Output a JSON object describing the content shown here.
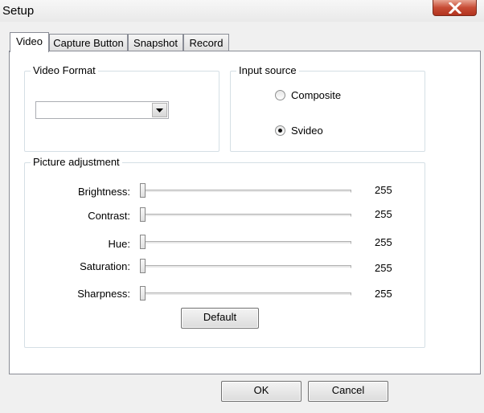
{
  "window": {
    "title": "Setup",
    "close_icon": "close-icon"
  },
  "tabs": [
    {
      "label": "Video",
      "active": true
    },
    {
      "label": "Capture Button",
      "active": false
    },
    {
      "label": "Snapshot",
      "active": false
    },
    {
      "label": "Record",
      "active": false
    }
  ],
  "video_format": {
    "title": "Video Format",
    "selected": ""
  },
  "input_source": {
    "title": "Input source",
    "options": [
      {
        "label": "Composite",
        "checked": false
      },
      {
        "label": "Svideo",
        "checked": true
      }
    ]
  },
  "picture_adjustment": {
    "title": "Picture adjustment",
    "sliders": [
      {
        "label": "Brightness:",
        "value": "255",
        "fraction": 0
      },
      {
        "label": "Contrast:",
        "value": "255",
        "fraction": 0
      },
      {
        "label": "Hue:",
        "value": "255",
        "fraction": 0
      },
      {
        "label": "Saturation:",
        "value": "255",
        "fraction": 0
      },
      {
        "label": "Sharpness:",
        "value": "255",
        "fraction": 0
      }
    ],
    "default_label": "Default"
  },
  "footer": {
    "ok_label": "OK",
    "cancel_label": "Cancel"
  }
}
